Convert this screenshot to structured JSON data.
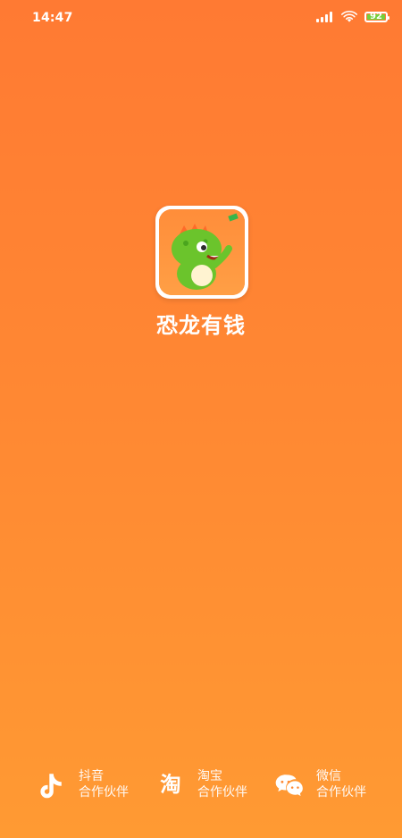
{
  "status_bar": {
    "time": "14:47",
    "battery_level": 92
  },
  "app": {
    "name": "恐龙有钱",
    "logo_icon": "dinosaur-app-logo-icon"
  },
  "partners": [
    {
      "name": "抖音",
      "label": "合作伙伴",
      "icon": "douyin-icon"
    },
    {
      "name": "淘宝",
      "label": "合作伙伴",
      "icon": "taobao-icon"
    },
    {
      "name": "微信",
      "label": "合作伙伴",
      "icon": "wechat-icon"
    }
  ],
  "colors": {
    "background_top": "#FF7A33",
    "background_bottom": "#FF9A33",
    "dino_green": "#6BC42C",
    "battery_green": "#73D13D"
  }
}
